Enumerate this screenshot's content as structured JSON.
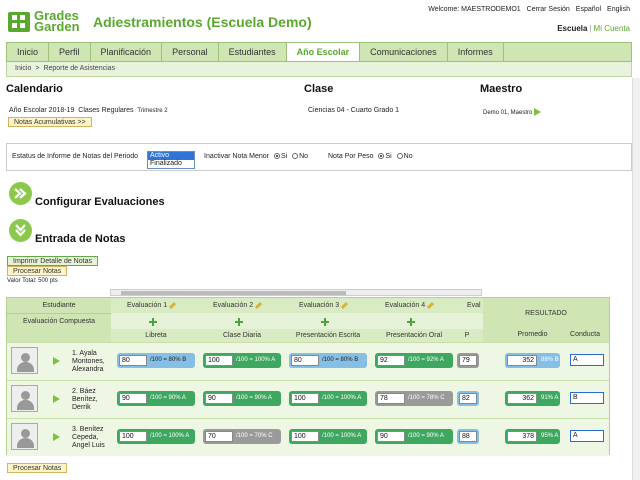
{
  "brand": {
    "line1": "Grades",
    "line2": "Garden"
  },
  "app_title": "Adiestramientos (Escuela Demo)",
  "topbar": {
    "welcome": "Welcome: MAESTRODEMO1",
    "logout": "Cerrar Sesión",
    "lang_es": "Español",
    "lang_en": "English"
  },
  "account": {
    "school": "Escuela",
    "sep": "|",
    "my_account": "Mi Cuenta"
  },
  "nav": [
    "Inicio",
    "Perfil",
    "Planificación",
    "Personal",
    "Estudiantes",
    "Año Escolar",
    "Comunicaciones",
    "Informes"
  ],
  "nav_active_index": 5,
  "breadcrumb": {
    "home": "Inicio",
    "sep": ">",
    "current": "Reporte de Asistencias"
  },
  "calendario": {
    "title": "Calendario",
    "year": "Año Escolar 2018-19",
    "classes": "Clases Regulares",
    "term": "Trimestre 2",
    "button": "Notas Acumulativas >>"
  },
  "clase": {
    "title": "Clase",
    "value": "Ciencias 04 -  Cuarto Grado  1"
  },
  "maestro": {
    "title": "Maestro",
    "value": "Demo 01, Maestro"
  },
  "filters": {
    "status_label": "Estatus de Informe de Notas del Periodo",
    "status_options": [
      "Activo",
      "Finalizado"
    ],
    "minor_label": "Inactivar Nota Menor",
    "peso_label": "Nota Por Peso",
    "si": "Si",
    "no": "No"
  },
  "sections": {
    "config": "Configurar Evaluaciones",
    "entry": "Entrada de Notas"
  },
  "actions": {
    "print": "Imprimir Detalle de Notas",
    "process": "Procesar Notas",
    "total": "Valor Total: 500 pts"
  },
  "grid": {
    "header_student": "Estudiante",
    "header_composite": "Evaluación Compuesta",
    "header_result": "RESULTADO",
    "evaluations": [
      "Evaluación 1",
      "Evaluación 2",
      "Evaluación 3",
      "Evaluación 4",
      "Eval"
    ],
    "eval_names": [
      "Libreta",
      "Clase Diaria",
      "Presentación Escrita",
      "Presentación Oral",
      "P"
    ],
    "col_promedio": "Promedio",
    "col_conducta": "Conducta",
    "rows": [
      {
        "name": "1. Ayala Montones, Alexandra",
        "cells": [
          {
            "val": "80",
            "txt": "/100 = 80% B",
            "color": "blue"
          },
          {
            "val": "100",
            "txt": "/100 = 100% A",
            "color": "green"
          },
          {
            "val": "80",
            "txt": "/100 = 80% B",
            "color": "blue"
          },
          {
            "val": "92",
            "txt": "/100 = 92% A",
            "color": "green"
          },
          {
            "val": "79",
            "txt": "",
            "color": "gray"
          }
        ],
        "promedio": "352",
        "prom_txt": "88% B",
        "prom_color": "blue",
        "conducta": "A"
      },
      {
        "name": "2. Báez Benítez, Derrik",
        "cells": [
          {
            "val": "90",
            "txt": "/100 = 90% A",
            "color": "green"
          },
          {
            "val": "90",
            "txt": "/100 = 90% A",
            "color": "green"
          },
          {
            "val": "100",
            "txt": "/100 = 100% A",
            "color": "green"
          },
          {
            "val": "78",
            "txt": "/100 = 78% C",
            "color": "gray"
          },
          {
            "val": "82",
            "txt": "",
            "color": "blue"
          }
        ],
        "promedio": "362",
        "prom_txt": "91% A",
        "prom_color": "green",
        "conducta": "B"
      },
      {
        "name": "3. Benítez Cepeda, Angel Luis",
        "cells": [
          {
            "val": "100",
            "txt": "/100 = 100% A",
            "color": "green"
          },
          {
            "val": "70",
            "txt": "/100 = 70% C",
            "color": "gray"
          },
          {
            "val": "100",
            "txt": "/100 = 100% A",
            "color": "green"
          },
          {
            "val": "90",
            "txt": "/100 = 90% A",
            "color": "green"
          },
          {
            "val": "88",
            "txt": "",
            "color": "blue"
          }
        ],
        "promedio": "378",
        "prom_txt": "95% A",
        "prom_color": "green",
        "conducta": "A"
      }
    ]
  },
  "colors": {
    "brand": "#5aa82e",
    "nav_bg": "#cfe5b4",
    "green_cell": "#3fa860",
    "blue_cell": "#86bfe6",
    "gray_cell": "#9a9a9a"
  },
  "icons": {
    "logo": "grid-logo-icon",
    "arrow": "green-arrow-right-icon",
    "plus": "green-plus-icon",
    "avatar": "person-silhouette-icon",
    "pencil": "pencil-icon",
    "chevrons": "double-chevron-icon"
  }
}
